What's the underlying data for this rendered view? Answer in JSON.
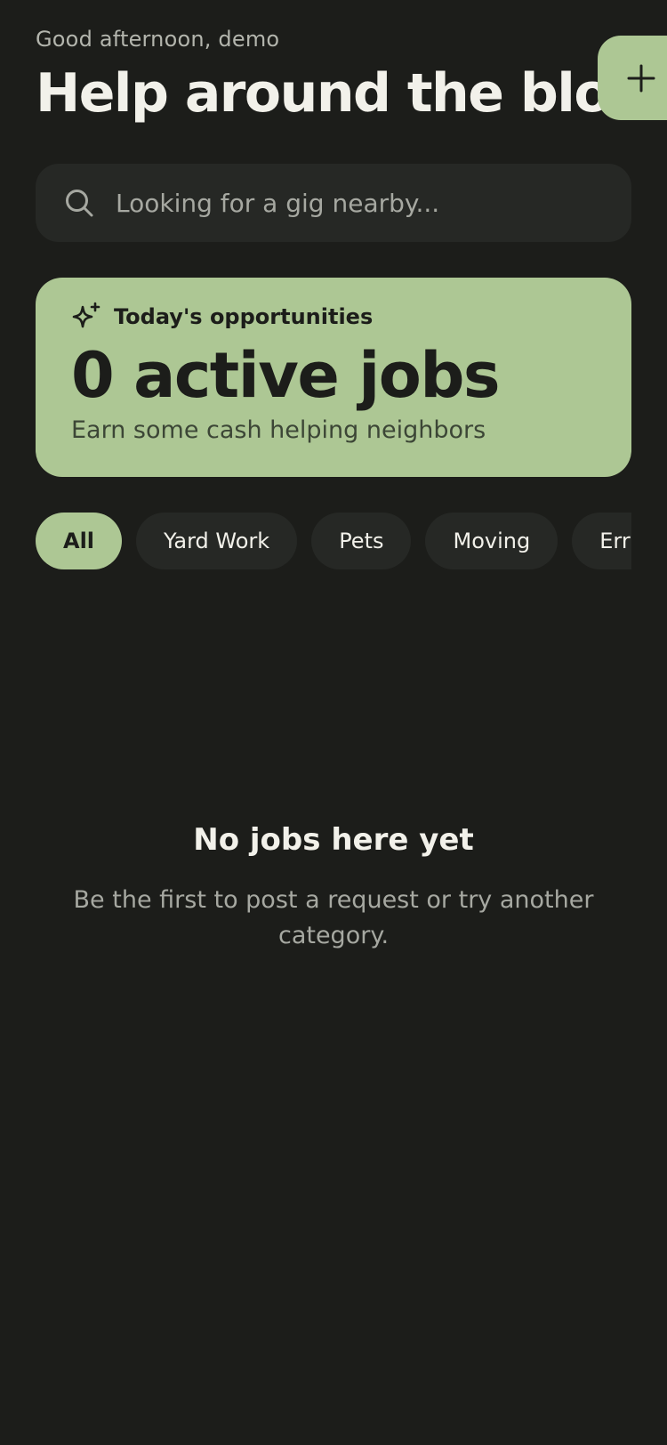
{
  "header": {
    "greeting": "Good afternoon, demo",
    "title": "Help around the block"
  },
  "fab": {
    "icon": "plus-icon"
  },
  "search": {
    "placeholder": "Looking for a gig nearby...",
    "icon": "search-icon"
  },
  "hero": {
    "icon": "sparkle-icon",
    "label": "Today's opportunities",
    "count": "0 active jobs",
    "subtitle": "Earn some cash helping neighbors"
  },
  "categories": {
    "selected": "All",
    "items": [
      "All",
      "Yard Work",
      "Pets",
      "Moving",
      "Errands"
    ]
  },
  "empty_state": {
    "title": "No jobs here yet",
    "text": "Be the first to post a request or try another category."
  },
  "colors": {
    "background": "#1c1d1a",
    "surface": "#262825",
    "accent": "#adc794",
    "text_primary": "#f2f1ea",
    "text_secondary": "#a6a8a1"
  }
}
